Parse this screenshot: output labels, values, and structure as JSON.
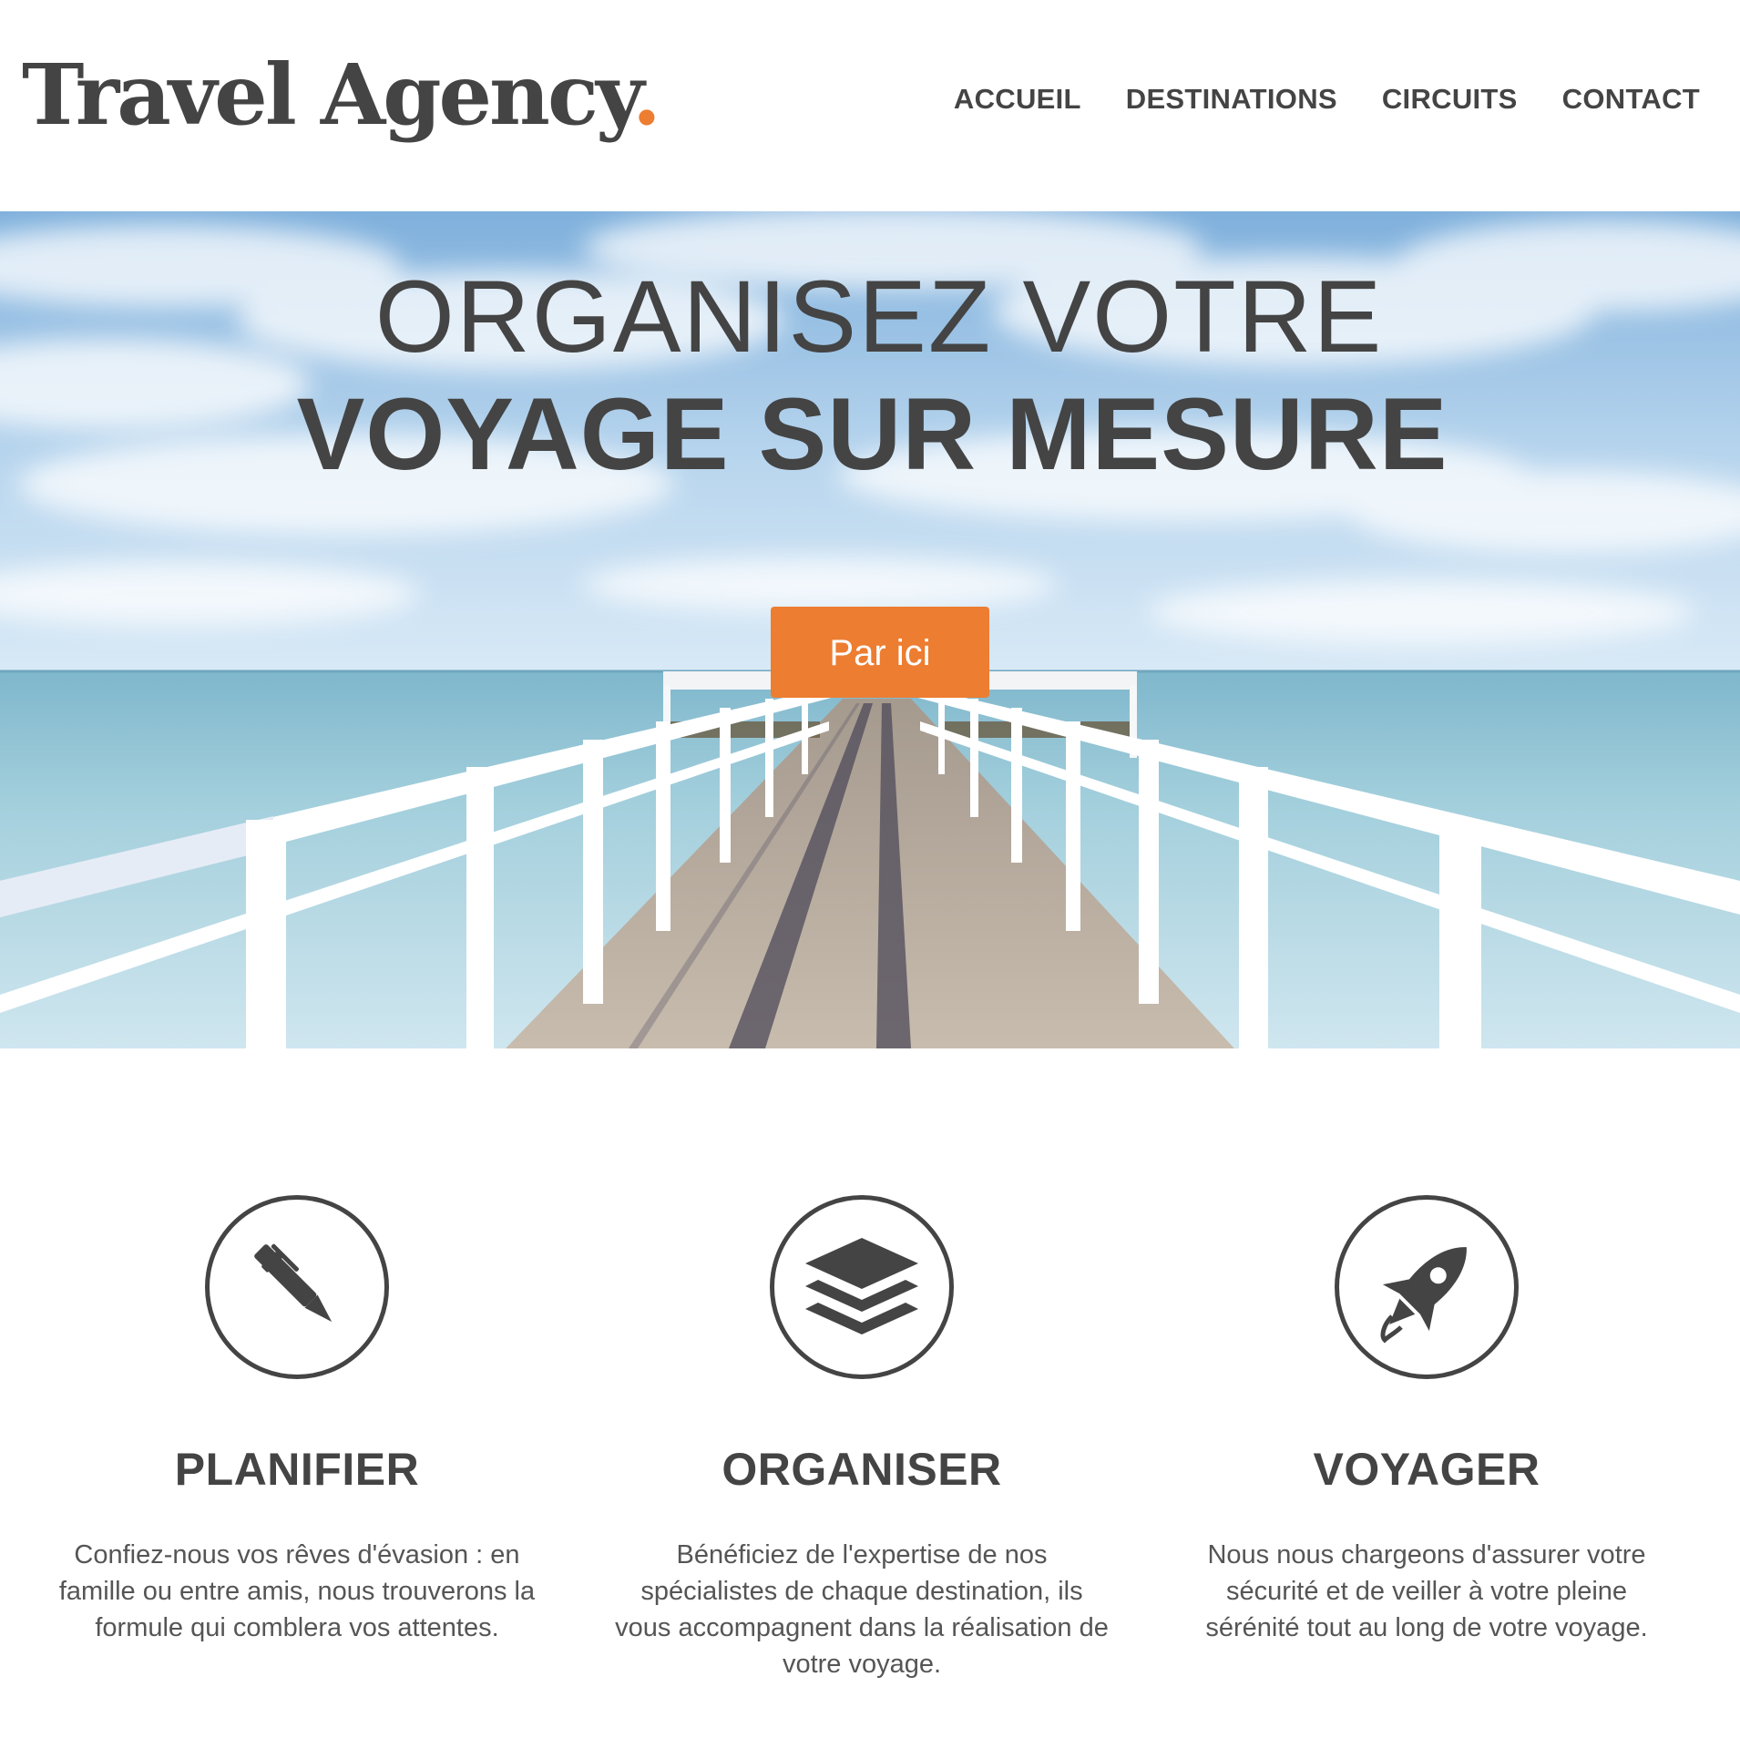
{
  "header": {
    "logo_text": "Travel Agency",
    "logo_dot": ".",
    "nav": [
      {
        "label": "ACCUEIL"
      },
      {
        "label": "DESTINATIONS"
      },
      {
        "label": "CIRCUITS"
      },
      {
        "label": "CONTACT"
      }
    ]
  },
  "hero": {
    "title_line1": "ORGANISEZ VOTRE",
    "title_line2": "VOYAGE SUR MESURE",
    "button_label": "Par ici"
  },
  "features": [
    {
      "icon": "pen-icon",
      "title": "PLANIFIER",
      "text": "Confiez-nous vos rêves d'évasion : en famille ou entre amis, nous trouverons la formule qui comblera vos attentes."
    },
    {
      "icon": "layers-icon",
      "title": "ORGANISER",
      "text": "Bénéficiez de l'expertise de nos spécialistes de chaque destination, ils vous accompagnent dans la réalisation de votre voyage."
    },
    {
      "icon": "rocket-icon",
      "title": "VOYAGER",
      "text": "Nous nous chargeons d'assurer votre sécurité et de veiller à votre pleine sérénité tout au long de votre voyage."
    }
  ],
  "colors": {
    "accent": "#ed7d31",
    "text": "#444444",
    "sky": "#a9cbe8",
    "sea": "#8fc0d4"
  }
}
